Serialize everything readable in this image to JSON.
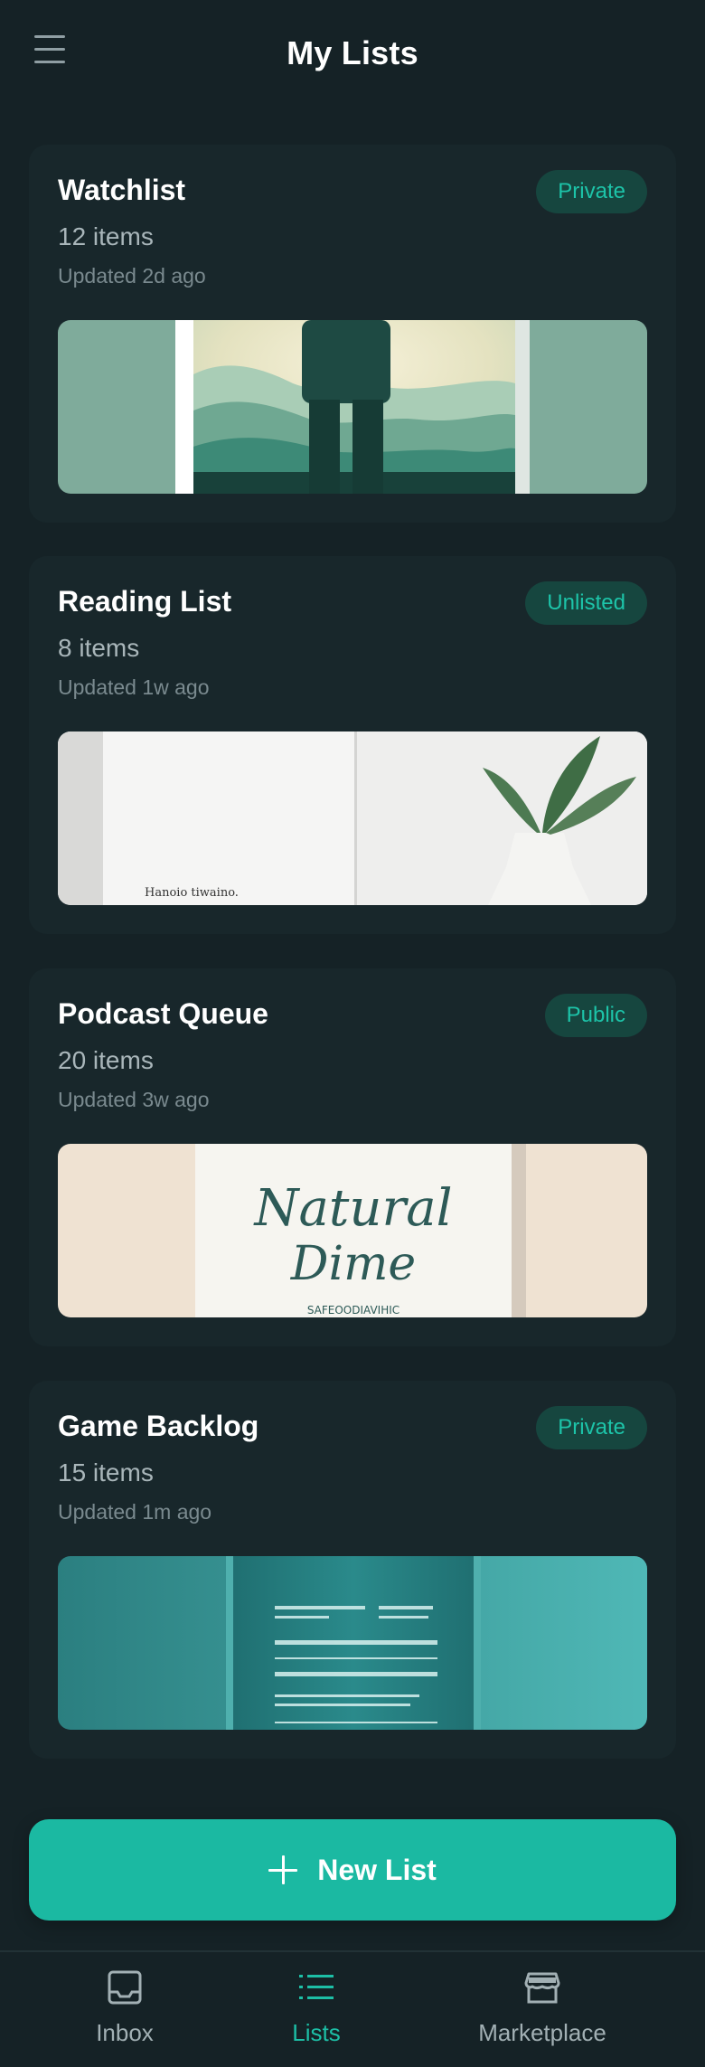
{
  "header": {
    "title": "My Lists"
  },
  "lists": [
    {
      "title": "Watchlist",
      "badge": "Private",
      "count": "12 items",
      "updated": "Updated 2d ago"
    },
    {
      "title": "Reading List",
      "badge": "Unlisted",
      "count": "8 items",
      "updated": "Updated 1w ago"
    },
    {
      "title": "Podcast Queue",
      "badge": "Public",
      "count": "20 items",
      "updated": "Updated 3w ago"
    },
    {
      "title": "Game Backlog",
      "badge": "Private",
      "count": "15 items",
      "updated": "Updated 1m ago"
    }
  ],
  "thumbnails": {
    "reading_caption": "Hanoio tiwaino.",
    "podcast_line1": "Natural",
    "podcast_line2": "Dime",
    "podcast_caption": "SAFEOODIAVIHIC"
  },
  "new_list": {
    "label": "New List",
    "icon": "plus-icon"
  },
  "nav": {
    "items": [
      {
        "label": "Inbox",
        "icon": "inbox-icon",
        "active": false
      },
      {
        "label": "Lists",
        "icon": "list-icon",
        "active": true
      },
      {
        "label": "Marketplace",
        "icon": "store-icon",
        "active": false
      }
    ]
  },
  "colors": {
    "background": "#152226",
    "card": "#18272b",
    "accent": "#1bb9a2",
    "badge_bg": "#16463f",
    "badge_text": "#1dc4a9"
  }
}
